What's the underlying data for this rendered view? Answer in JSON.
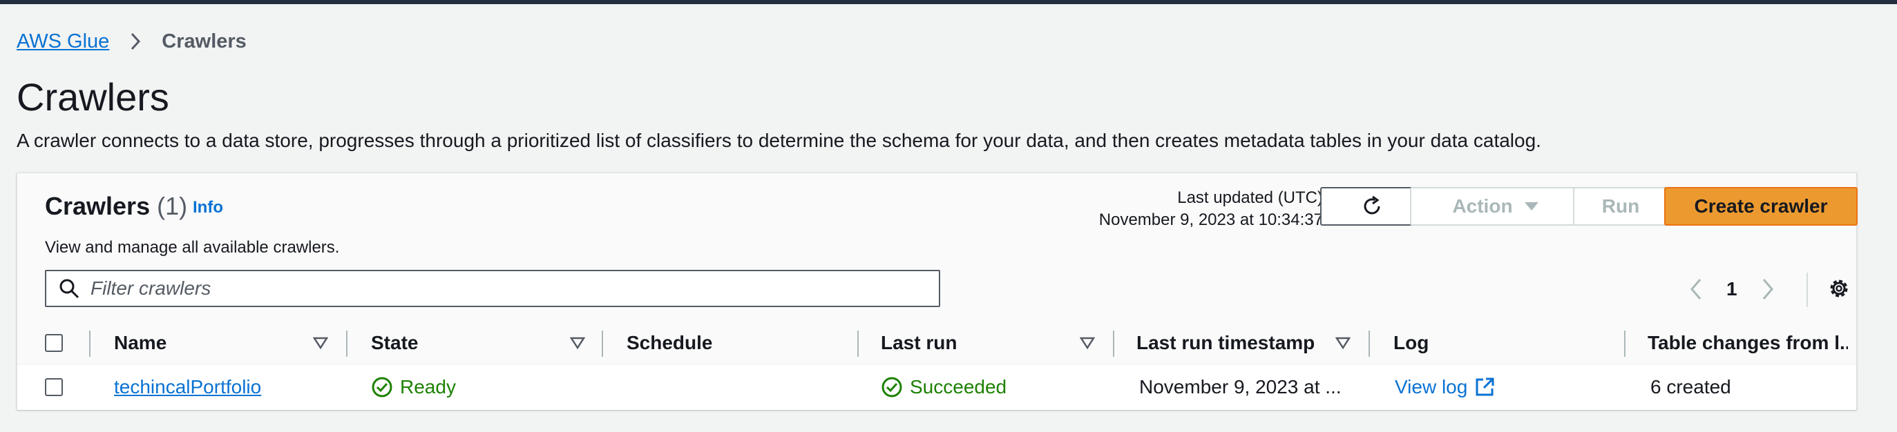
{
  "breadcrumb": {
    "root": "AWS Glue",
    "current": "Crawlers"
  },
  "page": {
    "title": "Crawlers",
    "description": "A crawler connects to a data store, progresses through a prioritized list of classifiers to determine the schema for your data, and then creates metadata tables in your data catalog."
  },
  "panel": {
    "title": "Crawlers",
    "count": "(1)",
    "info": "Info",
    "subtitle": "View and manage all available crawlers.",
    "last_updated_label": "Last updated (UTC)",
    "last_updated_value": "November 9, 2023 at 10:34:37",
    "buttons": {
      "action": "Action",
      "run": "Run",
      "create": "Create crawler"
    },
    "search_placeholder": "Filter crawlers",
    "page_number": "1"
  },
  "table": {
    "columns": [
      "Name",
      "State",
      "Schedule",
      "Last run",
      "Last run timestamp",
      "Log",
      "Table changes from l..."
    ],
    "rows": [
      {
        "name": "techincalPortfolio",
        "state": "Ready",
        "schedule": "",
        "last_run": "Succeeded",
        "last_run_timestamp": "November 9, 2023 at ...",
        "log": "View log",
        "table_changes": "6 created"
      }
    ]
  },
  "colors": {
    "accent_link": "#0972d3",
    "primary_button": "#ec9a30",
    "success": "#1d8102",
    "header_bar": "#232f3e"
  },
  "icons": [
    "chevron-right-icon",
    "refresh-icon",
    "caret-down-icon",
    "search-icon",
    "chevron-left-icon",
    "gear-icon",
    "sort-icon",
    "status-check-icon",
    "external-link-icon"
  ]
}
